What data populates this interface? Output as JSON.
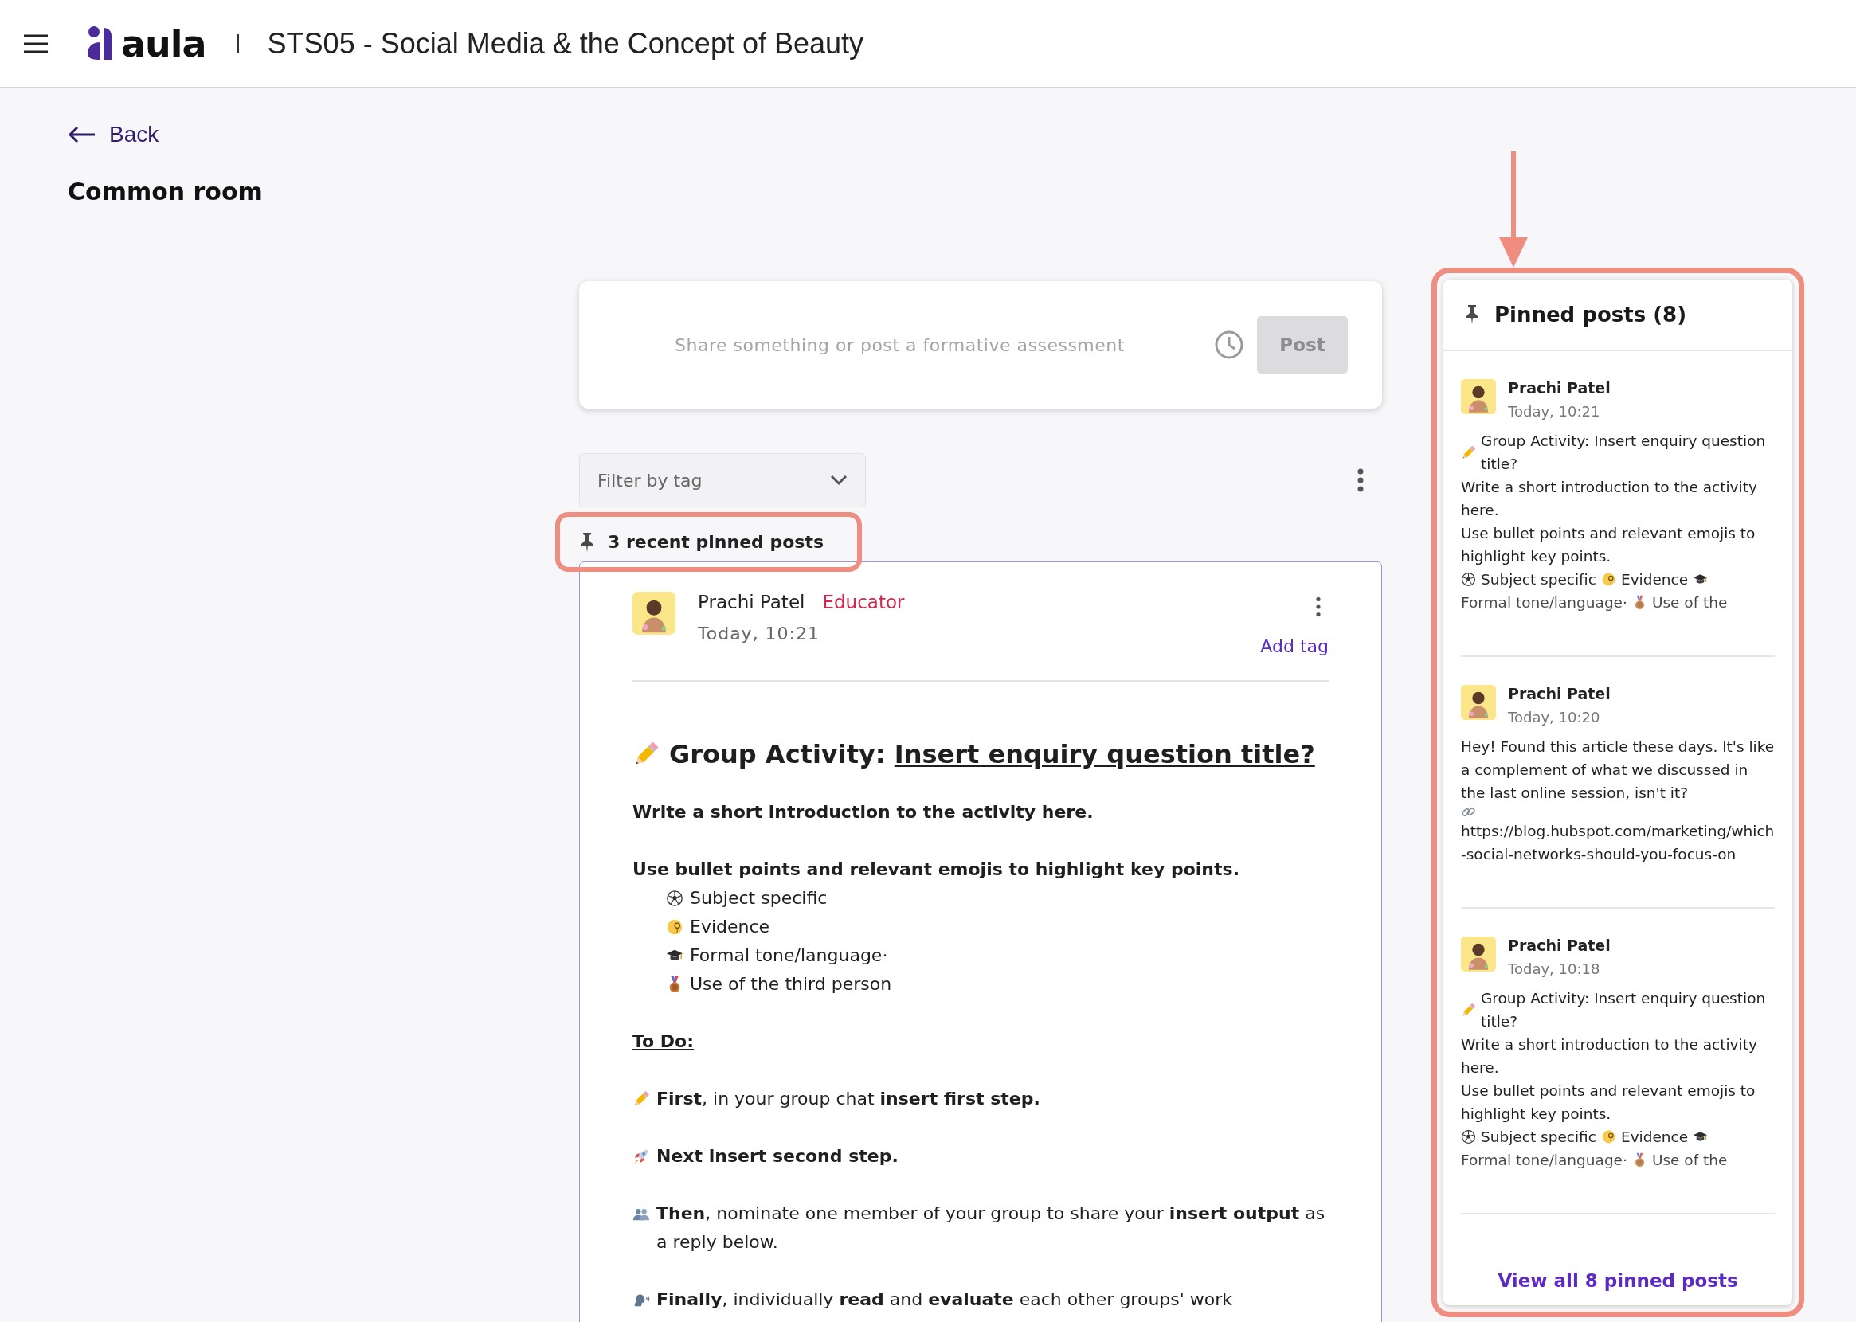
{
  "header": {
    "logo": "aula",
    "course_title": "STS05 - Social Media & the Concept of Beauty"
  },
  "back": "Back",
  "room_title": "Common room",
  "composer": {
    "placeholder": "Share something or post a formative assessment",
    "post_button": "Post",
    "post_disabled": true
  },
  "filter": {
    "placeholder": "Filter by tag"
  },
  "pinned_label": "3 recent pinned posts",
  "post": {
    "author": "Prachi Patel",
    "role": "Educator",
    "time": "Today, 10:21",
    "add_tag": "Add tag",
    "heading": {
      "kind": "pencil",
      "text": "Group Activity:",
      "underlined": "Insert enquiry question title?"
    },
    "intro": "Write a short introduction to the activity here.",
    "bullets_title": "Use bullet points and relevant emojis to highlight key points.",
    "bullets": [
      {
        "kind": "soccer",
        "text": "Subject specific"
      },
      {
        "kind": "monocle",
        "text": "Evidence"
      },
      {
        "kind": "cap",
        "text": "Formal tone/language·"
      },
      {
        "kind": "medal",
        "text": "Use of the third person"
      }
    ],
    "todo_title": "To Do:",
    "steps": [
      {
        "kind": "pencil",
        "text": "**First**, in your group chat **insert first step.**",
        "bold": false
      },
      {
        "kind": "rocket",
        "text": "Next insert second step.",
        "bold": true
      },
      {
        "kind": "people",
        "text": "**Then**, nominate one member of your group to share your **insert output** as a reply below.",
        "bold": false
      },
      {
        "kind": "speaker",
        "text": "**Finally**, individually **read** and **evaluate** each other groups' work",
        "bold": false
      }
    ]
  },
  "sidebar": {
    "title": "Pinned posts (8)",
    "view_all": "View all 8 pinned posts",
    "posts": [
      {
        "author": "Prachi Patel",
        "time": "Today, 10:21",
        "clipped": true,
        "paragraphs": [
          [
            {
              "kind": "pencil"
            },
            {
              "kind": "text",
              "text": "Group Activity: Insert enquiry question title?"
            }
          ],
          [
            {
              "kind": "text",
              "text": "Write a short introduction to the activity here."
            }
          ],
          [
            {
              "kind": "text",
              "text": "Use bullet points and relevant emojis to highlight key points."
            },
            {
              "kind": "soccer"
            },
            {
              "kind": "text",
              "text": "Subject specific"
            },
            {
              "kind": "monocle"
            },
            {
              "kind": "text",
              "text": "Evidence"
            },
            {
              "kind": "cap"
            },
            {
              "kind": "text",
              "text": "Formal tone/language·"
            },
            {
              "kind": "medal"
            },
            {
              "kind": "text",
              "text": "Use of the"
            }
          ]
        ]
      },
      {
        "author": "Prachi Patel",
        "time": "Today, 10:20",
        "clipped": false,
        "paragraphs": [
          [
            {
              "kind": "text",
              "text": "Hey! Found this article these days. It's like a complement of what we discussed in the last online session, isn't it?"
            }
          ],
          [
            {
              "kind": "link"
            }
          ],
          [
            {
              "kind": "text",
              "text": "https://blog.hubspot.com/marketing/which-social-networks-should-you-focus-on"
            }
          ]
        ]
      },
      {
        "author": "Prachi Patel",
        "time": "Today, 10:18",
        "clipped": true,
        "paragraphs": [
          [
            {
              "kind": "pencil"
            },
            {
              "kind": "text",
              "text": "Group Activity: Insert enquiry question title?"
            }
          ],
          [
            {
              "kind": "text",
              "text": "Write a short introduction to the activity here."
            }
          ],
          [
            {
              "kind": "text",
              "text": "Use bullet points and relevant emojis to highlight key points."
            },
            {
              "kind": "soccer"
            },
            {
              "kind": "text",
              "text": "Subject specific"
            },
            {
              "kind": "monocle"
            },
            {
              "kind": "text",
              "text": "Evidence"
            },
            {
              "kind": "cap"
            },
            {
              "kind": "text",
              "text": "Formal tone/language·"
            },
            {
              "kind": "medal"
            },
            {
              "kind": "text",
              "text": "Use of the"
            }
          ]
        ]
      }
    ]
  }
}
